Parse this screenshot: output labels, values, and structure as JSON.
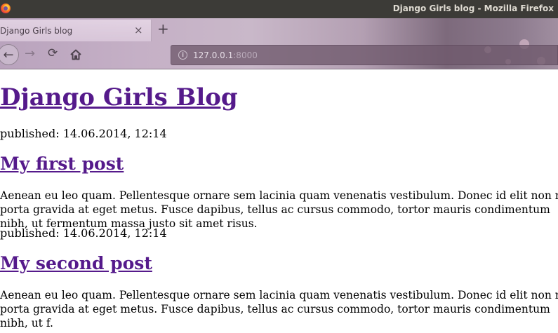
{
  "window": {
    "title": "Django Girls blog - Mozilla Firefox"
  },
  "browser": {
    "tab_title": "Django Girls blog",
    "tab_close": "×",
    "new_tab": "+",
    "url_host": "127.0.0.1",
    "url_port": ":8000",
    "icons": {
      "back": "←",
      "forward": "→",
      "reload": "⟳",
      "info": "i"
    }
  },
  "page": {
    "blog_title": "Django Girls Blog",
    "posts": [
      {
        "published": "published: 14.06.2014, 12:14",
        "title": "My first post",
        "text": "Aenean eu leo quam. Pellentesque ornare sem lacinia quam venenatis vestibulum. Donec id elit non mi porta gravida at eget metus. Fusce dapibus, tellus ac cursus commodo, tortor mauris condimentum nibh, ut fermentum massa justo sit amet risus."
      },
      {
        "published": "published: 14.06.2014, 12:14",
        "title": "My second post",
        "text": "Aenean eu leo quam. Pellentesque ornare sem lacinia quam venenatis vestibulum. Donec id elit non mi porta gravida at eget metus. Fusce dapibus, tellus ac cursus commodo, tortor mauris condimentum nibh, ut f."
      }
    ]
  },
  "colors": {
    "link_visited": "#551a8b",
    "titlebar": "#3c3b37"
  }
}
